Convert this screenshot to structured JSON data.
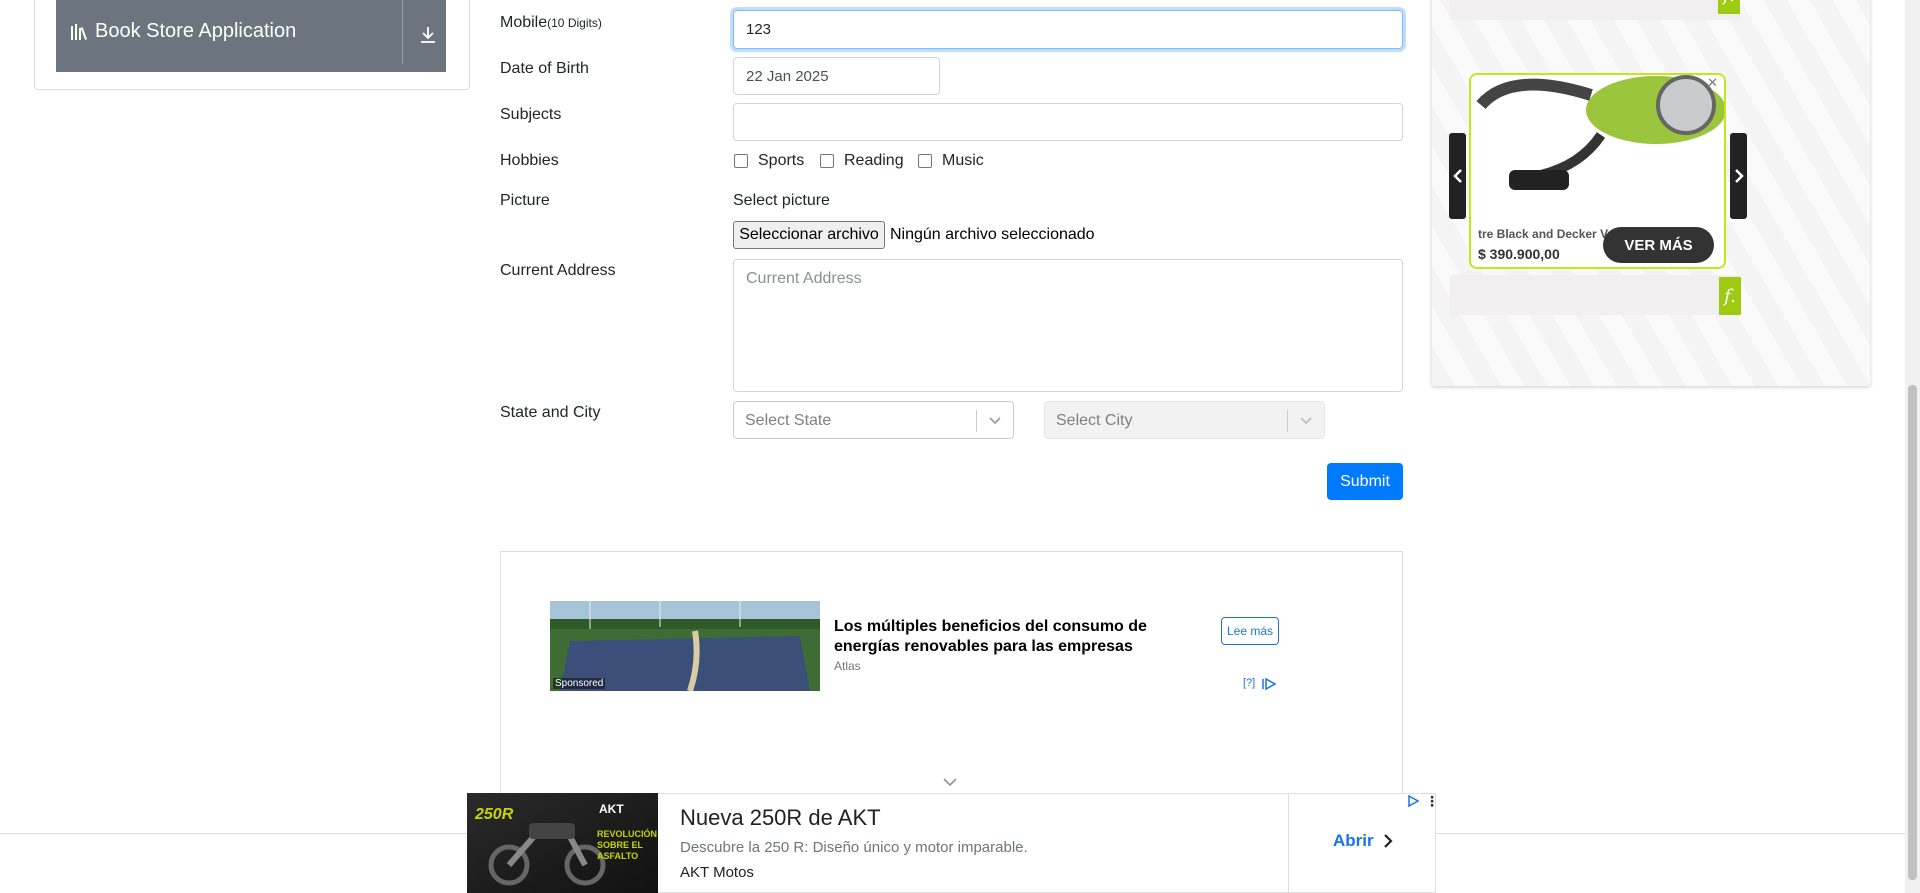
{
  "sidebar": {
    "book_store_label": "Book Store Application"
  },
  "form": {
    "mobile_label": "Mobile",
    "mobile_hint": "(10 Digits)",
    "mobile_value": "123",
    "dob_label": "Date of Birth",
    "dob_value": "22 Jan 2025",
    "subjects_label": "Subjects",
    "subjects_value": "",
    "hobbies_label": "Hobbies",
    "hobbies": [
      {
        "label": "Sports",
        "checked": false
      },
      {
        "label": "Reading",
        "checked": false
      },
      {
        "label": "Music",
        "checked": false
      }
    ],
    "picture_label": "Picture",
    "picture_hint": "Select picture",
    "file_button": "Seleccionar archivo",
    "file_status": "Ningún archivo seleccionado",
    "address_label": "Current Address",
    "address_placeholder": "Current Address",
    "state_city_label": "State and City",
    "state_placeholder": "Select State",
    "city_placeholder": "Select City",
    "submit_label": "Submit"
  },
  "content_ad": {
    "title": "Los múltiples beneficios del consumo de energías renovables para las empresas",
    "source": "Atlas",
    "cta": "Lee más",
    "sponsored": "Sponsored",
    "help": "[?]"
  },
  "side_ad": {
    "product_name": "tre Black and Decker VC",
    "price": "$ 390.900,00",
    "cta": "VER MÁS",
    "logo": "f.",
    "accent": "#c6e51b"
  },
  "sticky_ad": {
    "title": "Nueva 250R de AKT",
    "description": "Descubre la 250 R: Diseño único y motor imparable.",
    "brand": "AKT Motos",
    "cta": "Abrir",
    "image_text": "REVOLUCIÓN SOBRE EL ASFALTO"
  },
  "colors": {
    "primary": "#007bff",
    "sidebar_button": "#6c757d",
    "focus_border": "#80bdff"
  }
}
